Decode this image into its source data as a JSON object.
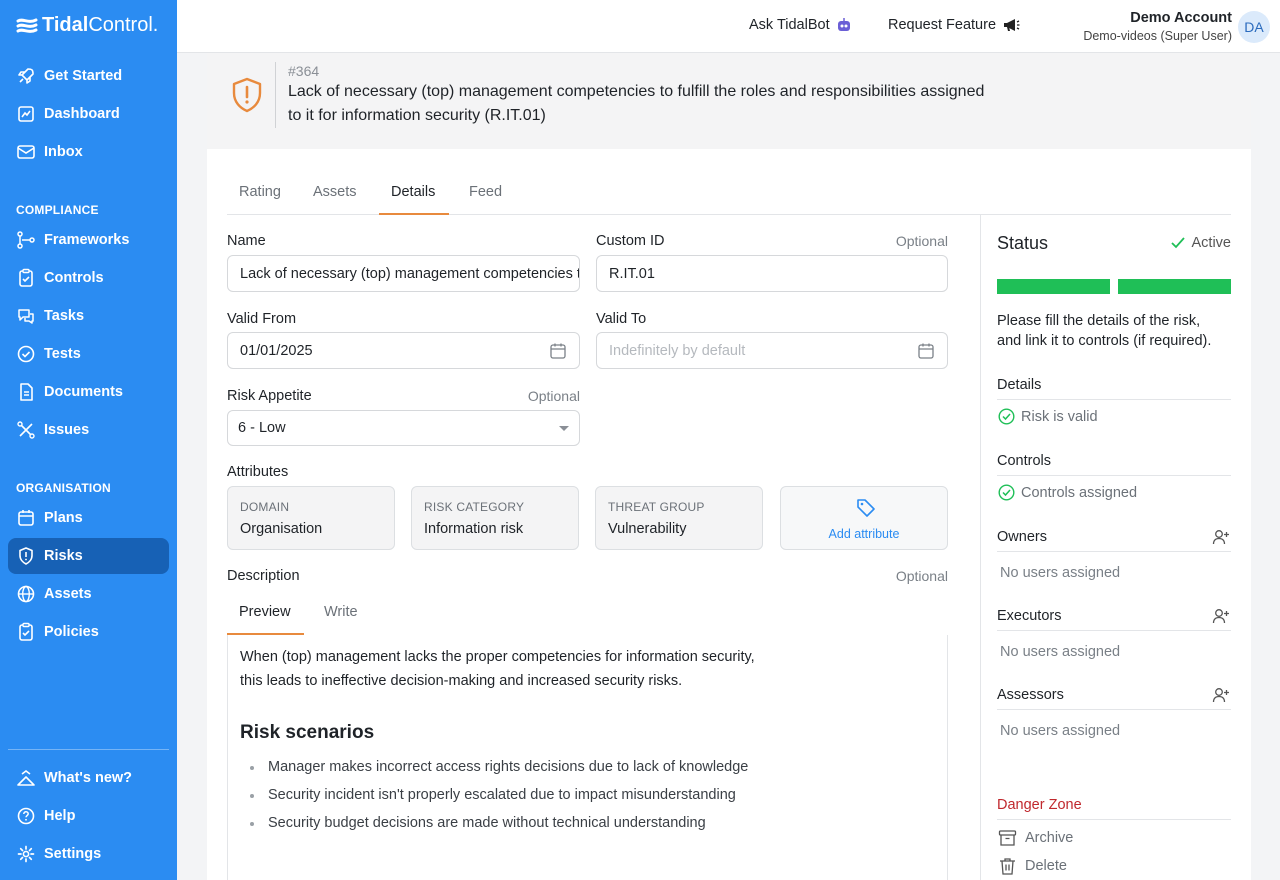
{
  "brand": {
    "bold": "Tidal",
    "light": "Control."
  },
  "sidebar": {
    "top": [
      {
        "label": "Get Started",
        "icon": "rocket-icon"
      },
      {
        "label": "Dashboard",
        "icon": "dashboard-icon"
      },
      {
        "label": "Inbox",
        "icon": "inbox-icon"
      }
    ],
    "compliance_title": "COMPLIANCE",
    "compliance": [
      {
        "label": "Frameworks",
        "icon": "frameworks-icon"
      },
      {
        "label": "Controls",
        "icon": "controls-icon"
      },
      {
        "label": "Tasks",
        "icon": "tasks-icon"
      },
      {
        "label": "Tests",
        "icon": "tests-icon"
      },
      {
        "label": "Documents",
        "icon": "documents-icon"
      },
      {
        "label": "Issues",
        "icon": "issues-icon"
      }
    ],
    "organisation_title": "ORGANISATION",
    "organisation": [
      {
        "label": "Plans",
        "icon": "calendar-icon"
      },
      {
        "label": "Risks",
        "icon": "shield-icon",
        "active": true
      },
      {
        "label": "Assets",
        "icon": "globe-icon"
      },
      {
        "label": "Policies",
        "icon": "policies-icon"
      }
    ],
    "bottom": [
      {
        "label": "What's new?",
        "icon": "megaphone-icon"
      },
      {
        "label": "Help",
        "icon": "help-icon"
      },
      {
        "label": "Settings",
        "icon": "gear-icon"
      }
    ]
  },
  "topbar": {
    "ask": "Ask TidalBot",
    "request": "Request Feature",
    "account_name": "Demo Account",
    "account_sub": "Demo-videos (Super User)",
    "avatar": "DA"
  },
  "risk": {
    "id": "#364",
    "title": "Lack of necessary (top) management competencies to fulfill the roles and responsibilities assigned to it for information security (R.IT.01)"
  },
  "tabs": [
    "Rating",
    "Assets",
    "Details",
    "Feed"
  ],
  "form": {
    "name_label": "Name",
    "name_value": "Lack of necessary (top) management competencies to fulfill",
    "custom_id_label": "Custom ID",
    "optional": "Optional",
    "custom_id_value": "R.IT.01",
    "valid_from_label": "Valid From",
    "valid_from_value": "01/01/2025",
    "valid_to_label": "Valid To",
    "valid_to_placeholder": "Indefinitely by default",
    "appetite_label": "Risk Appetite",
    "appetite_value": "6 - Low",
    "attributes_label": "Attributes",
    "attributes": [
      {
        "key": "DOMAIN",
        "value": "Organisation"
      },
      {
        "key": "RISK CATEGORY",
        "value": "Information risk"
      },
      {
        "key": "THREAT GROUP",
        "value": "Vulnerability"
      }
    ],
    "add_attribute": "Add attribute",
    "description_label": "Description"
  },
  "description": {
    "tabs": [
      "Preview",
      "Write"
    ],
    "paragraph_1": "When (top) management lacks the proper competencies for information security,",
    "paragraph_2": "this leads to ineffective decision-making and increased security risks.",
    "heading": "Risk scenarios",
    "bullets": [
      "Manager makes incorrect access rights decisions due to lack of knowledge",
      "Security incident isn't properly escalated due to impact misunderstanding",
      "Security budget decisions are made without technical understanding"
    ]
  },
  "status": {
    "title": "Status",
    "state": "Active",
    "progress_segments": 2,
    "progress_complete": 2,
    "progress_color": "#1fbf57",
    "hint_1": "Please fill the details of the risk,",
    "hint_2": "and link it to controls (if required).",
    "details_title": "Details",
    "details_check": "Risk is valid",
    "controls_title": "Controls",
    "controls_check": "Controls assigned",
    "owners_title": "Owners",
    "executors_title": "Executors",
    "assessors_title": "Assessors",
    "no_users": "No users assigned",
    "danger_title": "Danger Zone",
    "archive": "Archive",
    "delete": "Delete"
  }
}
